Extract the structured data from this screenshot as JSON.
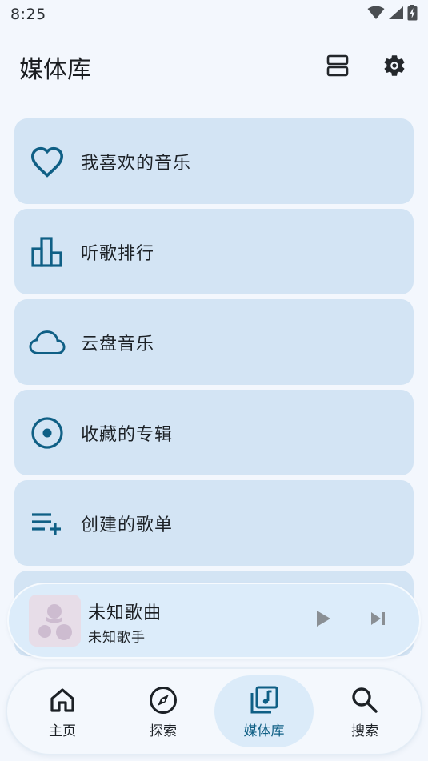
{
  "status_bar": {
    "time": "8:25",
    "icons": [
      "wifi-icon",
      "signal-icon",
      "battery-charging-icon"
    ]
  },
  "header": {
    "title": "媒体库",
    "actions": [
      "layout-toggle-icon",
      "settings-gear-icon"
    ]
  },
  "colors": {
    "accent": "#0f5f85",
    "card_bg": "#d3e4f4",
    "page_bg": "#f3f7fd",
    "active_nav_bg": "#dbebf9"
  },
  "library": {
    "items": [
      {
        "label": "我喜欢的音乐",
        "icon": "heart-icon"
      },
      {
        "label": "听歌排行",
        "icon": "bar-chart-icon"
      },
      {
        "label": "云盘音乐",
        "icon": "cloud-icon"
      },
      {
        "label": "收藏的专辑",
        "icon": "album-disc-icon"
      },
      {
        "label": "创建的歌单",
        "icon": "playlist-add-icon"
      }
    ]
  },
  "player": {
    "title": "未知歌曲",
    "artist": "未知歌手",
    "controls": [
      "play-icon",
      "skip-next-icon"
    ]
  },
  "bottom_nav": {
    "items": [
      {
        "label": "主页",
        "icon": "home-icon",
        "active": false
      },
      {
        "label": "探索",
        "icon": "compass-icon",
        "active": false
      },
      {
        "label": "媒体库",
        "icon": "library-music-icon",
        "active": true
      },
      {
        "label": "搜索",
        "icon": "search-icon",
        "active": false
      }
    ]
  }
}
